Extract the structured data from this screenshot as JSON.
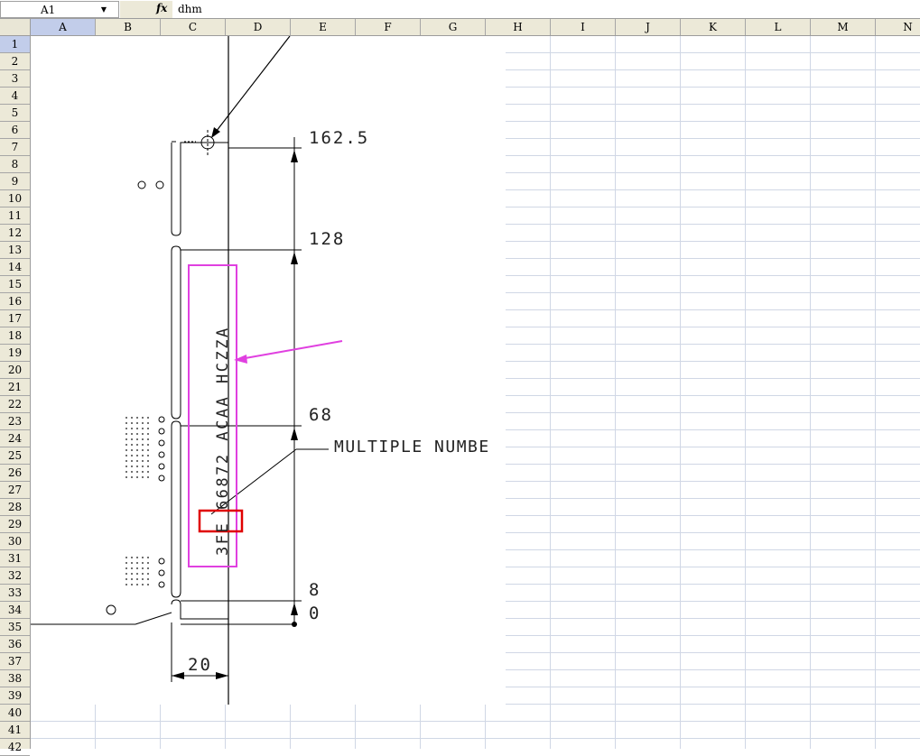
{
  "formula_bar": {
    "name_box": "A1",
    "fx_symbol": "fx",
    "formula": "dhm"
  },
  "columns": [
    "A",
    "B",
    "C",
    "D",
    "E",
    "F",
    "G",
    "H",
    "I",
    "J",
    "K",
    "L",
    "M",
    "N"
  ],
  "rows": [
    "1",
    "2",
    "3",
    "4",
    "5",
    "6",
    "7",
    "8",
    "9",
    "10",
    "11",
    "12",
    "13",
    "14",
    "15",
    "16",
    "17",
    "18",
    "19",
    "20",
    "21",
    "22",
    "23",
    "24",
    "25",
    "26",
    "27",
    "28",
    "29",
    "30",
    "31",
    "32",
    "33",
    "34",
    "35",
    "36",
    "37",
    "38",
    "39",
    "40",
    "41",
    "42"
  ],
  "drawing": {
    "dimensions": {
      "dim_162_5": "162.5",
      "dim_128": "128",
      "dim_68": "68",
      "dim_8": "8",
      "dim_0": "0",
      "dim_20": "20"
    },
    "vertical_label": "3FE 66872 ACAA HCZZA",
    "callout": "MULTIPLE NUMBE",
    "colors": {
      "magenta": "#e040e0",
      "red": "#e00000",
      "line": "#000000"
    }
  }
}
